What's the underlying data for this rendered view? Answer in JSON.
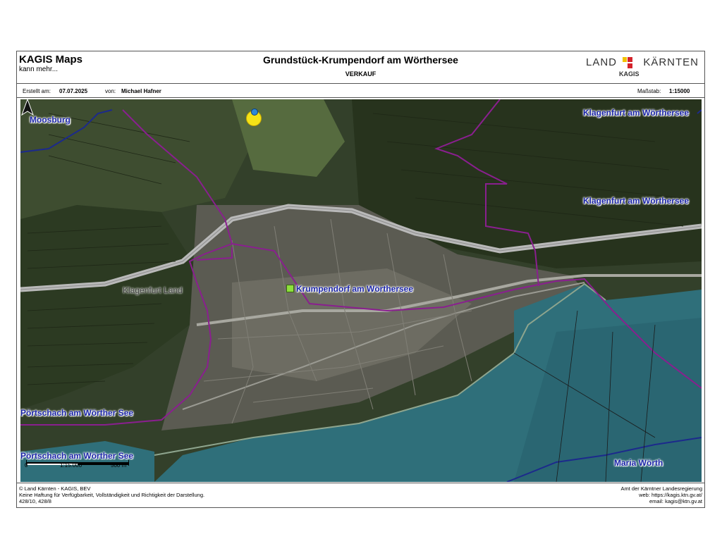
{
  "header": {
    "app_title": "KAGIS Maps",
    "app_subtitle": "kann mehr...",
    "doc_title": "Grundstück-Krumpendorf am Wörthersee",
    "doc_subtitle": "VERKAUF",
    "logo_left": "LAND",
    "logo_right": "KÄRNTEN",
    "logo_sub": "KAGIS"
  },
  "infobar": {
    "created_label": "Erstellt am:",
    "created_value": "07.07.2025",
    "by_label": "von:",
    "by_value": "Michael Hafner",
    "scale_label": "Maßstab:",
    "scale_value": "1:15000"
  },
  "map": {
    "places": {
      "moosburg": "Moosburg",
      "klagenfurt_1": "Klagenfurt am Wörthersee",
      "klagenfurt_2": "Klagenfurt am Wörthersee",
      "klagenfurt_land": "Klagenfurt Land",
      "krumpendorf": "Krumpendorf am Wörthersee",
      "poertschach_1": "Pörtschach am Wörther See",
      "poertschach_2": "Pörtschach am Wörther See",
      "maria_woerth": "Maria Wörth"
    },
    "scalebar": {
      "zero": "0",
      "ratio": "1:15.000",
      "distance": "500 m"
    },
    "colors": {
      "lake": "#2f6f7a",
      "boundary": "#8a1f8f",
      "district_line": "#1c2a8c",
      "forest": "#2b3720",
      "road": "#b9b9b9"
    }
  },
  "footer": {
    "left_1": "© Land Kärnten - KAGIS, BEV",
    "left_2": "Keine Haftung für Verfügbarkeit, Vollständigkeit und Richtigkeit der Darstellung.",
    "left_3": "428/10, 428/8",
    "right_1": "Amt der Kärntner Landesregierung",
    "right_2": "web: https://kagis.ktn.gv.at/",
    "right_3": "email: kagis@ktn.gv.at"
  }
}
